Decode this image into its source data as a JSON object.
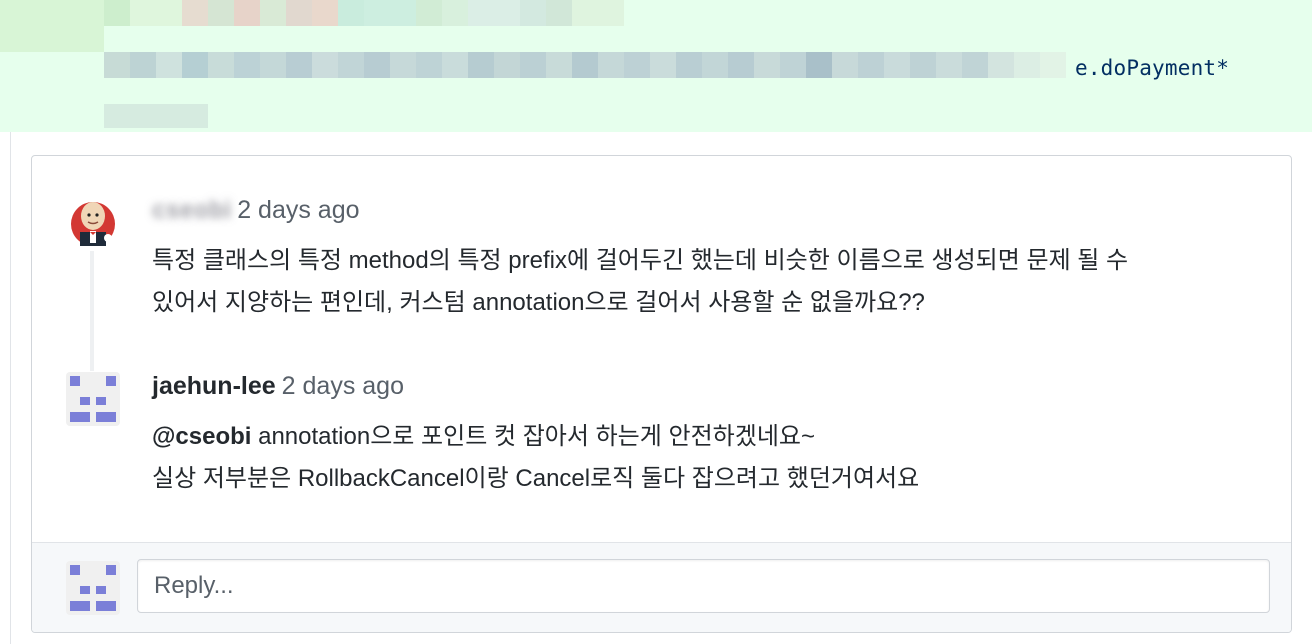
{
  "diff_line": {
    "visible_code": "e.doPayment*",
    "visible_code_prefix_dim": "",
    "next_line_fragment": "(..))"
  },
  "comments": [
    {
      "author": "cseobi",
      "time": "2 days ago",
      "body_lines": [
        "특정 클래스의 특정 method의 특정 prefix에 걸어두긴 했는데 비슷한 이름으로 생성되면 문제 될 수",
        "있어서 지양하는 편인데, 커스텀 annotation으로 걸어서 사용할 순 없을까요??"
      ],
      "avatar": "jenkins-butler-avatar"
    },
    {
      "author": "jaehun-lee",
      "time": "2 days ago",
      "mention": "@cseobi",
      "body_line1_rest": " annotation으로 포인트 컷 잡아서 하는게 안전하겠네요~",
      "body_line2": "실상 저부분은 RollbackCancel이랑 Cancel로직 둘다 잡으려고 했던거여서요",
      "avatar": "identicon-avatar"
    }
  ],
  "reply": {
    "placeholder": "Reply...",
    "value": ""
  },
  "colors": {
    "added_line_bg": "#e6ffed",
    "identicon": "#7b7fd8",
    "border": "#d1d5da"
  }
}
